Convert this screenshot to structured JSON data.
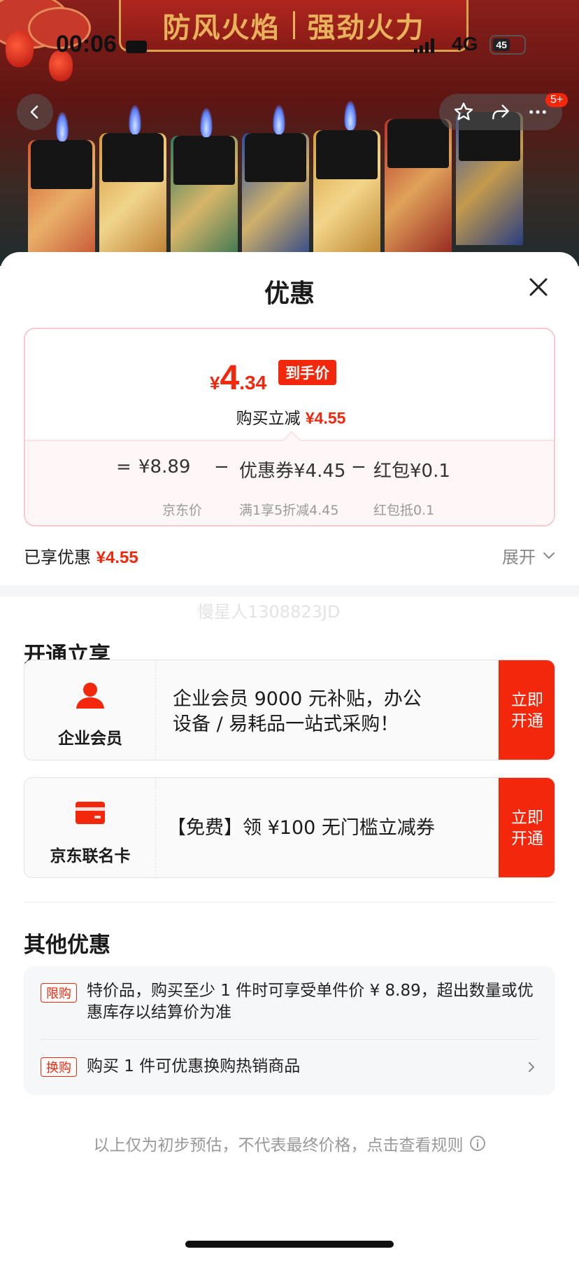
{
  "status_bar": {
    "time": "00:06",
    "network": "4G",
    "battery": "45"
  },
  "banner": {
    "left": "防风火焰",
    "right": "强劲火力"
  },
  "nav": {
    "notification_count": "5+"
  },
  "sheet": {
    "title": "优惠"
  },
  "price_card": {
    "currency": "¥",
    "final_int": "4",
    "final_dec": ".34",
    "final_tag": "到手价",
    "reduce_label": "购买立减",
    "reduce_value": "¥4.55",
    "formula": {
      "equals": "=",
      "jd_price": "¥8.89",
      "minus1": "−",
      "coupon": "优惠券¥4.45",
      "minus2": "−",
      "redpacket": "红包¥0.1",
      "jd_price_label": "京东价",
      "coupon_label": "满1享5折减4.45",
      "redpacket_label": "红包抵0.1"
    }
  },
  "enjoyed": {
    "label": "已享优惠",
    "value": "¥4.55",
    "expand_label": "展开"
  },
  "watermark": "慢星人1308823JD",
  "open_section": {
    "title": "开通立享",
    "cards": [
      {
        "name": "企业会员",
        "icon": "user-icon",
        "text": "企业会员 9000 元补贴，办公设备 / 易耗品一站式采购！",
        "button_l1": "立即",
        "button_l2": "开通"
      },
      {
        "name": "京东联名卡",
        "icon": "card-icon",
        "text": "【免费】领 ¥100 无门槛立减券",
        "button_l1": "立即",
        "button_l2": "开通"
      }
    ]
  },
  "other_section": {
    "title": "其他优惠",
    "items": [
      {
        "tag": "限购",
        "text": "特价品，购买至少 1 件时可享受单件价 ¥ 8.89，超出数量或优惠库存以结算价为准"
      },
      {
        "tag": "换购",
        "text": "购买 1 件可优惠换购热销商品"
      }
    ]
  },
  "footnote": "以上仅为初步预估，不代表最终价格，点击查看规则",
  "colors": {
    "accent": "#f2270c",
    "card_border": "#f7c8cf",
    "muted": "#999999"
  }
}
